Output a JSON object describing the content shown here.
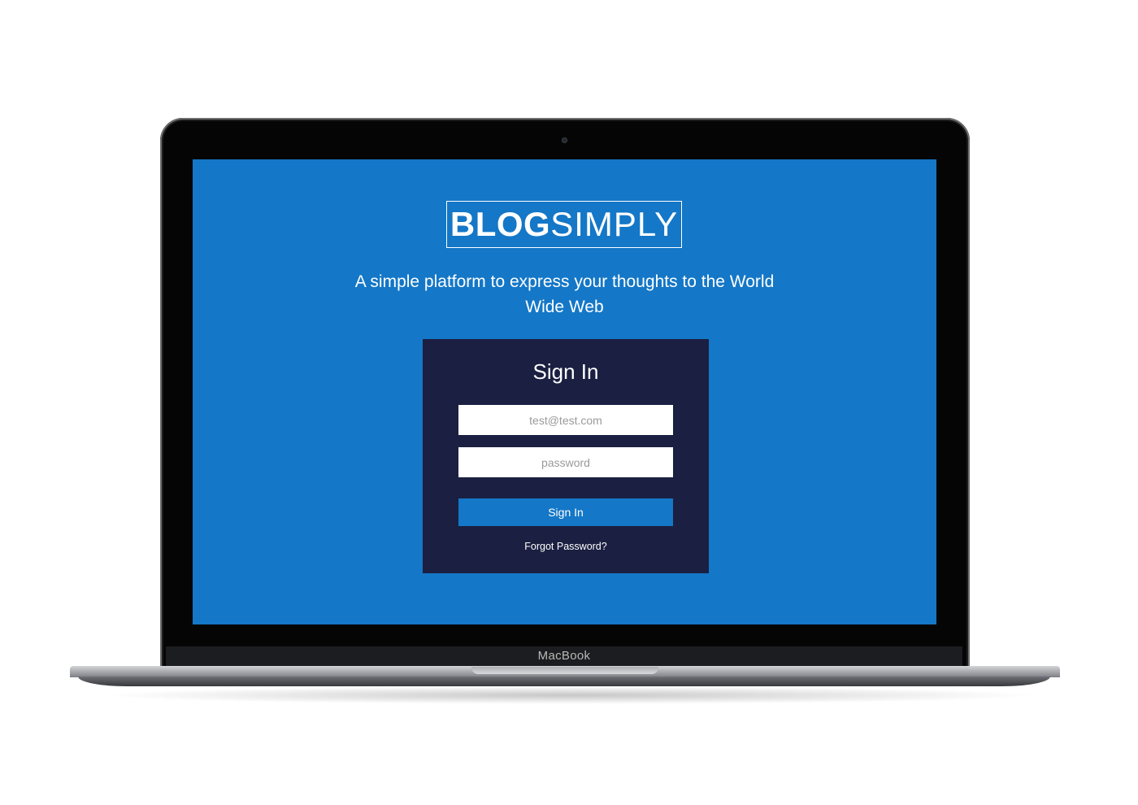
{
  "device": {
    "brand_label": "MacBook"
  },
  "logo": {
    "bold_text": "BLOG",
    "light_text": "SIMPLY"
  },
  "tagline": "A simple platform to express your thoughts to the World Wide Web",
  "signin_card": {
    "title": "Sign In",
    "email_placeholder": "test@test.com",
    "password_placeholder": "password",
    "button_label": "Sign In",
    "forgot_link": "Forgot Password?"
  },
  "colors": {
    "screen_background": "#1477c7",
    "card_background": "#1b1f41",
    "button_background": "#1477c7"
  }
}
